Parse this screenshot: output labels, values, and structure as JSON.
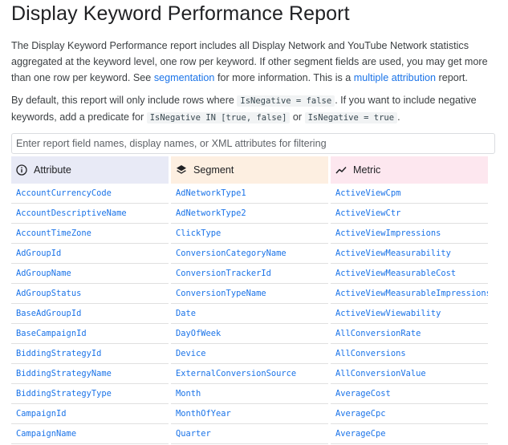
{
  "page": {
    "title": "Display Keyword Performance Report",
    "intro": {
      "text1": "The Display Keyword Performance report includes all Display Network and YouTube Network statistics aggregated at the keyword level, one row per keyword. If other segment fields are used, you may get more than one row per keyword. See ",
      "link1": "segmentation",
      "text2": " for more information. This is a ",
      "link2": "multiple attribution",
      "text3": " report."
    },
    "default_note": {
      "text1": "By default, this report will only include rows where ",
      "code1": "IsNegative = false",
      "text2": ". If you want to include negative keywords, add a predicate for ",
      "code2": "IsNegative IN [true, false]",
      "text3": " or ",
      "code3": "IsNegative = true",
      "text4": "."
    },
    "filter": {
      "placeholder": "Enter report field names, display names, or XML attributes for filtering"
    }
  },
  "table": {
    "columns": [
      {
        "header": "Attribute",
        "icon": "info-circle-icon",
        "color": "#e8eaf6",
        "items": [
          "AccountCurrencyCode",
          "AccountDescriptiveName",
          "AccountTimeZone",
          "AdGroupId",
          "AdGroupName",
          "AdGroupStatus",
          "BaseAdGroupId",
          "BaseCampaignId",
          "BiddingStrategyId",
          "BiddingStrategyName",
          "BiddingStrategyType",
          "CampaignId",
          "CampaignName"
        ]
      },
      {
        "header": "Segment",
        "icon": "layers-icon",
        "color": "#fdefe1",
        "items": [
          "AdNetworkType1",
          "AdNetworkType2",
          "ClickType",
          "ConversionCategoryName",
          "ConversionTrackerId",
          "ConversionTypeName",
          "Date",
          "DayOfWeek",
          "Device",
          "ExternalConversionSource",
          "Month",
          "MonthOfYear",
          "Quarter"
        ]
      },
      {
        "header": "Metric",
        "icon": "trending-line-icon",
        "color": "#fde7ef",
        "items": [
          "ActiveViewCpm",
          "ActiveViewCtr",
          "ActiveViewImpressions",
          "ActiveViewMeasurability",
          "ActiveViewMeasurableCost",
          "ActiveViewMeasurableImpressions",
          "ActiveViewViewability",
          "AllConversionRate",
          "AllConversions",
          "AllConversionValue",
          "AverageCost",
          "AverageCpc",
          "AverageCpe"
        ]
      }
    ]
  }
}
